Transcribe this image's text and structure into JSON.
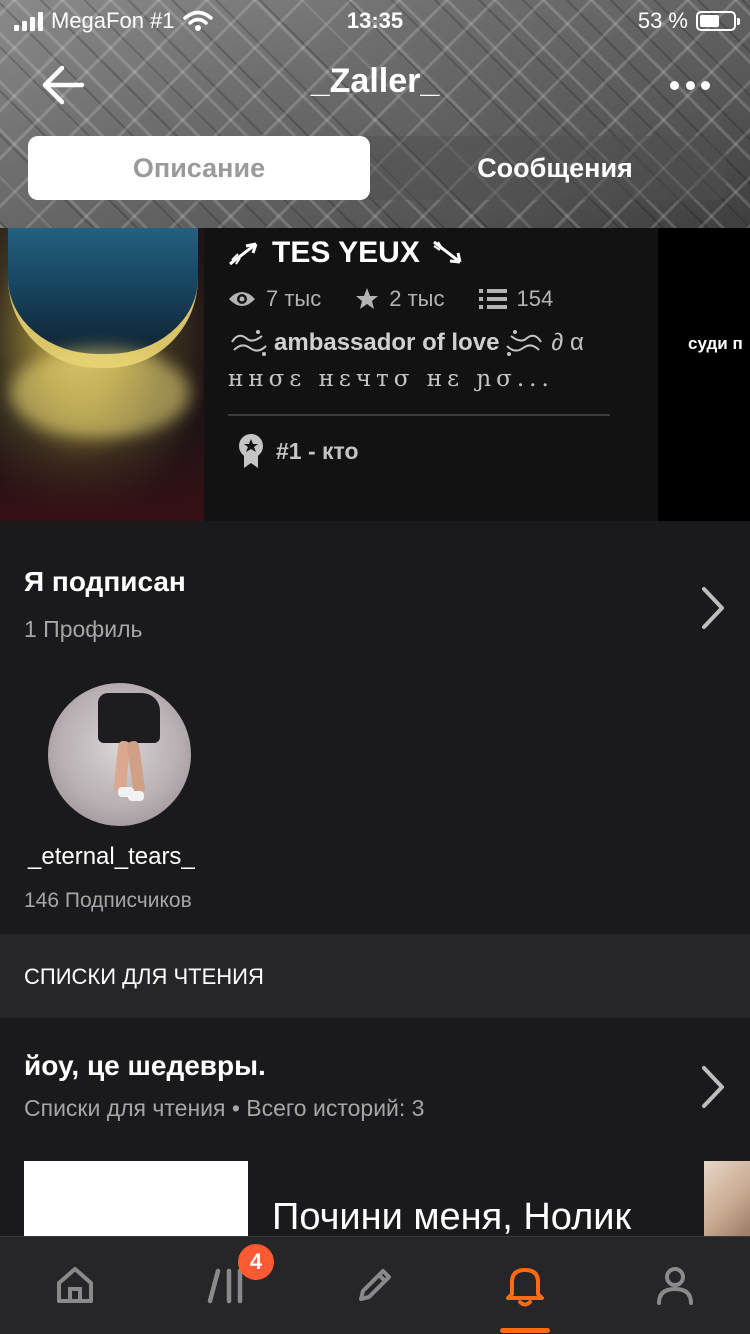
{
  "status_bar": {
    "carrier": "MegaFon #1",
    "time": "13:35",
    "battery_text": "53 %"
  },
  "header": {
    "title": "_Zaller_",
    "tabs": [
      {
        "label": "Описание",
        "active": true
      },
      {
        "label": "Сообщения",
        "active": false
      }
    ]
  },
  "story": {
    "title": "TES YEUX",
    "views": "7 тыс",
    "votes": "2 тыс",
    "parts": "154",
    "description_bold": "ambassador of love",
    "description_tail": "∂ α",
    "description_line2": "ннσε нεчтσ нε ɲσ...",
    "rank": "#1 - кто",
    "next_cover_text": "суди п"
  },
  "following": {
    "title": "Я подписан",
    "subtitle": "1 Профиль",
    "users": [
      {
        "name": "_eternal_tears_",
        "followers": "146 Подписчиков"
      }
    ]
  },
  "reading_lists": {
    "header": "СПИСКИ ДЛЯ ЧТЕНИЯ",
    "title": "йоу, це шедевры.",
    "subtitle": "Списки для чтения • Всего историй: 3",
    "first_story_title": "Почини меня, Нолик"
  },
  "tabbar": {
    "items": [
      "home-icon",
      "library-icon",
      "write-icon",
      "notifications-icon",
      "profile-icon"
    ],
    "active": "notifications-icon",
    "badge": "4",
    "accent_color": "#ff6a13"
  }
}
